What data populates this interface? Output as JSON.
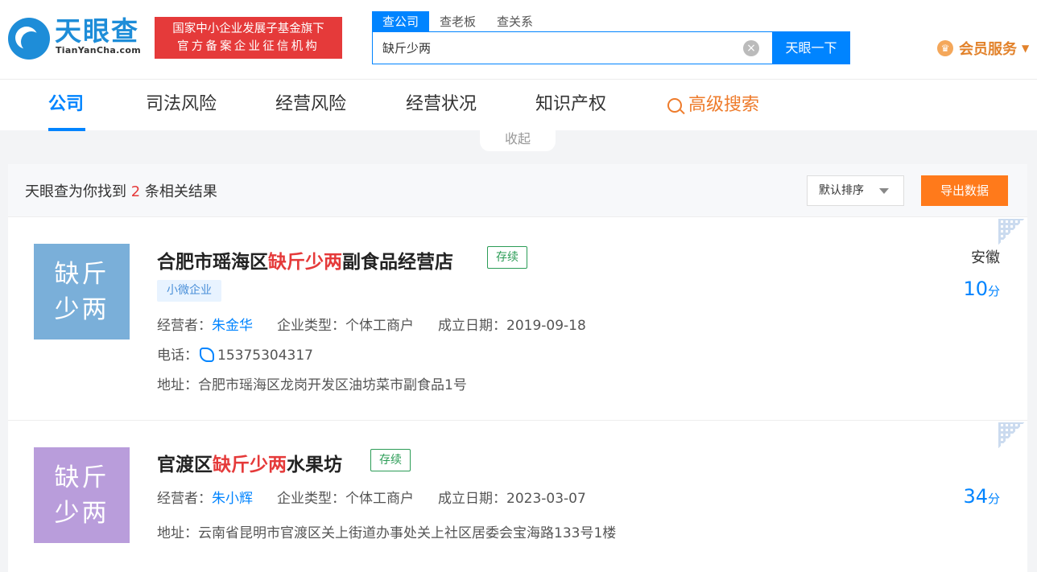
{
  "header": {
    "logo_text": "天眼查",
    "logo_domain": "TianYanCha.com",
    "banner_line1": "国家中小企业发展子基金旗下",
    "banner_line2": "官方备案企业征信机构",
    "search_tabs": [
      "查公司",
      "查老板",
      "查关系"
    ],
    "search_value": "缺斤少两",
    "search_button": "天眼一下",
    "member_label": "会员服务"
  },
  "nav": {
    "items": [
      "公司",
      "司法风险",
      "经营风险",
      "经营状况",
      "知识产权"
    ],
    "advanced_search": "高级搜索",
    "collapse_label": "收起"
  },
  "results": {
    "summary_prefix": "天眼查为你找到",
    "count": "2",
    "summary_suffix": "条相关结果",
    "sort_label": "默认排序",
    "export_label": "导出数据",
    "colors": {
      "accent": "#0084ff",
      "highlight": "#e53a3a",
      "status": "#2b9c56",
      "export": "#ff7a1b"
    },
    "companies": [
      {
        "logo_line1": "缺斤",
        "logo_line2": "少两",
        "logo_color": "#7aafd9",
        "name_pre": "合肥市瑶海区",
        "name_hl": "缺斤少两",
        "name_post": "副食品经营店",
        "status": "存续",
        "tag": "小微企业",
        "operator_label": "经营者：",
        "operator": "朱金华",
        "type_label": "企业类型：",
        "type": "个体工商户",
        "date_label": "成立日期：",
        "date": "2019-09-18",
        "phone_label": "电话：",
        "phone": "15375304317",
        "address_label": "地址：",
        "address": "合肥市瑶海区龙岗开发区油坊菜市副食品1号",
        "region": "安徽",
        "score": "10",
        "score_unit": "分"
      },
      {
        "logo_line1": "缺斤",
        "logo_line2": "少两",
        "logo_color": "#b99ddb",
        "name_pre": "官渡区",
        "name_hl": "缺斤少两",
        "name_post": "水果坊",
        "status": "存续",
        "operator_label": "经营者：",
        "operator": "朱小辉",
        "type_label": "企业类型：",
        "type": "个体工商户",
        "date_label": "成立日期：",
        "date": "2023-03-07",
        "address_label": "地址：",
        "address": "云南省昆明市官渡区关上街道办事处关上社区居委会宝海路133号1楼",
        "score": "34",
        "score_unit": "分"
      }
    ]
  }
}
